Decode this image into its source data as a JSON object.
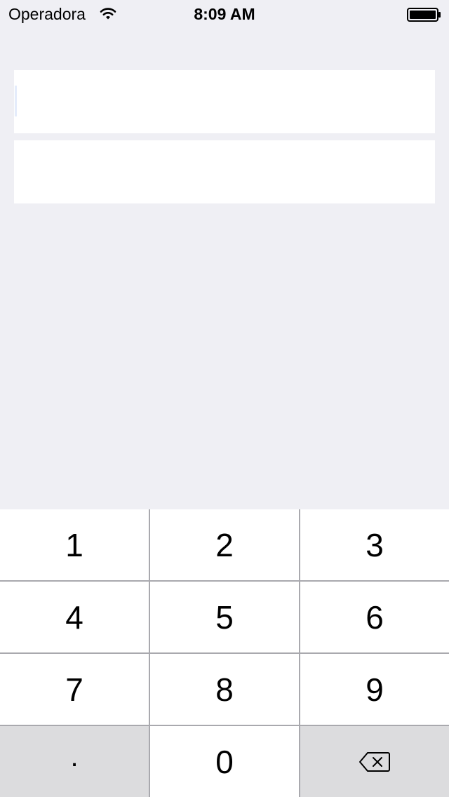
{
  "status_bar": {
    "carrier": "Operadora",
    "time": "8:09 AM",
    "icons": [
      "wifi-icon",
      "battery-icon"
    ]
  },
  "form": {
    "field_1": {
      "value": "",
      "placeholder": ""
    },
    "field_2": {
      "value": "",
      "placeholder": ""
    }
  },
  "keypad": {
    "keys": [
      "1",
      "2",
      "3",
      "4",
      "5",
      "6",
      "7",
      "8",
      "9",
      ".",
      "0"
    ],
    "delete_icon": "delete-backward-icon"
  },
  "colors": {
    "background": "#efeff4",
    "field": "#ffffff",
    "key": "#ffffff",
    "key_function": "#dcdcde",
    "key_separator": "#a9a9ae"
  }
}
